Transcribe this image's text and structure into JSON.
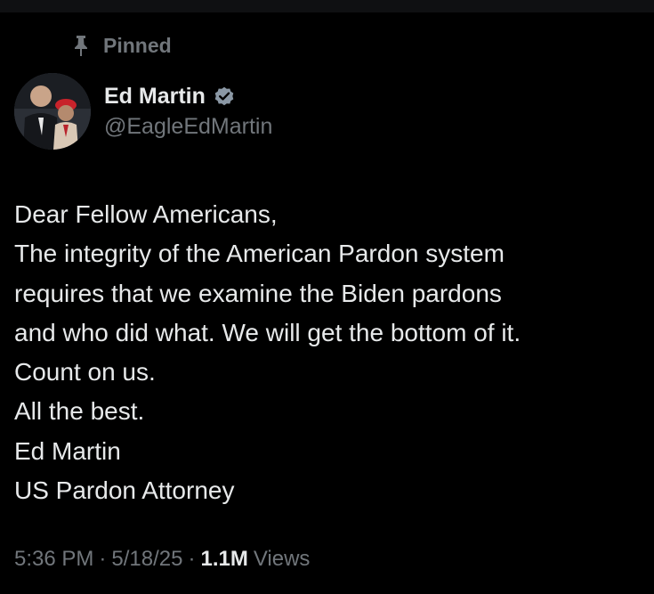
{
  "pinned_label": "Pinned",
  "author": {
    "display_name": "Ed Martin",
    "handle": "@EagleEdMartin",
    "verified": true
  },
  "post": {
    "lines": [
      "Dear Fellow Americans,",
      "The integrity of the American Pardon system",
      "requires that we examine the Biden pardons",
      "and who did what. We will get the bottom of it.",
      "Count on us.",
      "All the best.",
      "Ed Martin",
      "US Pardon Attorney"
    ]
  },
  "meta": {
    "time": "5:36 PM",
    "separator": "·",
    "date": "5/18/25",
    "views_count": "1.1M",
    "views_label": "Views"
  },
  "colors": {
    "background": "#000000",
    "text_primary": "#e7e9ea",
    "text_secondary": "#71767b",
    "verified_badge": "#8b98a5"
  },
  "icons": {
    "pin": "pin-icon",
    "verified": "verified-badge-icon"
  }
}
